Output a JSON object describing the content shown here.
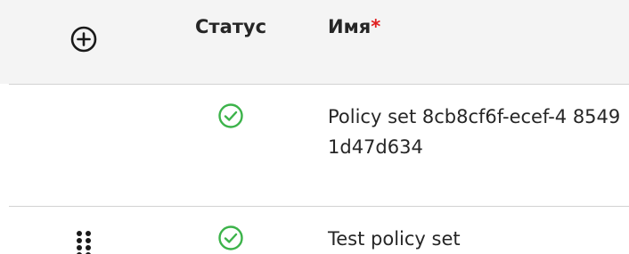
{
  "columns": {
    "add_icon": "plus-circle",
    "status": "Статус",
    "name": "Имя",
    "required_mark": "*"
  },
  "rows": [
    {
      "status_icon": "check-circle",
      "status_color": "#3cb34a",
      "name": "Policy set 8cb8cf6f-ecef-4 85491d47d634"
    },
    {
      "drag_icon": "drag-handle",
      "status_icon": "check-circle",
      "status_color": "#3cb34a",
      "name": "Test policy set"
    }
  ],
  "colors": {
    "header_bg": "#f4f4f4",
    "text": "#262626",
    "required": "#e02020",
    "success": "#3cb34a"
  }
}
